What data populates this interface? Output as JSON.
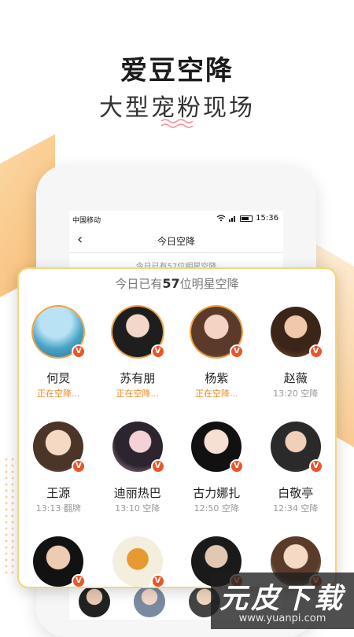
{
  "promo": {
    "title": "爱豆空降",
    "subtitle": "大型宠粉现场"
  },
  "status_bar": {
    "carrier": "中国移动",
    "time": "15:36"
  },
  "nav": {
    "back_icon": "‹",
    "title": "今日空降"
  },
  "screen_subtitle": "今日已有57位明星空降",
  "card": {
    "header_prefix": "今日已有",
    "count": "57",
    "header_suffix": "位明星空降",
    "stars": [
      {
        "name": "何炅",
        "status": "正在空降...",
        "live": true
      },
      {
        "name": "苏有朋",
        "status": "正在空降...",
        "live": true
      },
      {
        "name": "杨紫",
        "status": "正在空降...",
        "live": true
      },
      {
        "name": "赵薇",
        "status": "13:20 空降",
        "live": false
      },
      {
        "name": "王源",
        "status": "13:13 翻牌",
        "live": false
      },
      {
        "name": "迪丽热巴",
        "status": "13:10 空降",
        "live": false
      },
      {
        "name": "古力娜扎",
        "status": "12:50 空降",
        "live": false
      },
      {
        "name": "白敬亭",
        "status": "12:34 空降",
        "live": false
      },
      {
        "name": "",
        "status": "",
        "live": false
      },
      {
        "name": "",
        "status": "",
        "live": false
      },
      {
        "name": "",
        "status": "",
        "live": false
      },
      {
        "name": "",
        "status": "",
        "live": false
      }
    ]
  },
  "verified_badge": "V",
  "colors": {
    "accent": "#f08a1e",
    "badge": "#e8562a",
    "card_border": "#f3d77a"
  },
  "watermark": {
    "main": "元皮下载",
    "url": "www.yuanpi.com"
  }
}
